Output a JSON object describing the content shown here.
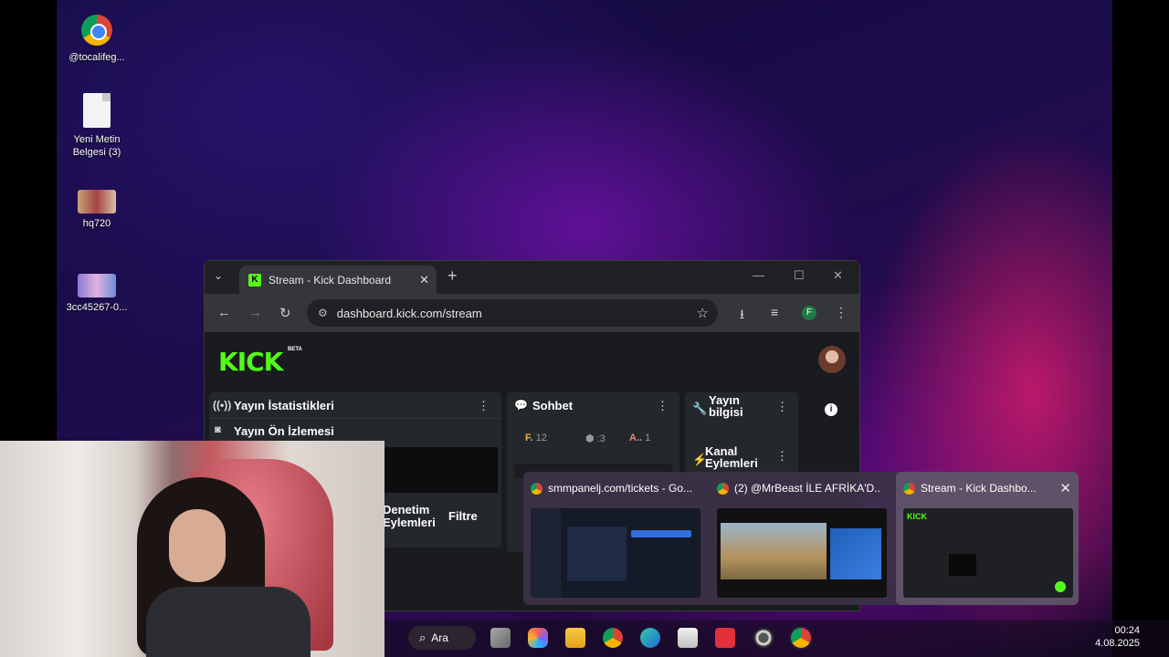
{
  "desktop": {
    "icons": [
      {
        "label": "@tocalifeg...",
        "icon": "chrome-shortcut-icon"
      },
      {
        "label": "Yeni Metin Belgesi (3)",
        "icon": "text-file-icon"
      },
      {
        "label": "hq720",
        "icon": "image-file-icon"
      },
      {
        "label": "3cc45267-0...",
        "icon": "image-file-icon"
      }
    ]
  },
  "browser": {
    "tab": {
      "title": "Stream - Kick Dashboard",
      "close": "✕"
    },
    "new_tab": "+",
    "controls": {
      "minimize": "—",
      "maximize": "☐",
      "close": "✕"
    },
    "url": "dashboard.kick.com/stream",
    "profile_initial": "F"
  },
  "kick": {
    "logo": "KICK",
    "beta": "BETA",
    "panels": {
      "stats": "Yayın İstatistikleri",
      "preview": "Yayın Ön İzlemesi",
      "chat": "Sohbet",
      "info": "Yayın bilgisi",
      "channel": "Kanal Eylemleri",
      "moderation": "Denetim Eylemleri",
      "filter": "Filtre"
    },
    "chat_chips": [
      {
        "name": "F.",
        "count": "12"
      },
      {
        "name": "",
        "count": "3"
      },
      {
        "name": "A..",
        "count": "1"
      }
    ]
  },
  "switcher": {
    "items": [
      {
        "title": "smmpanelj.com/tickets - Go..."
      },
      {
        "title": "(2) @MrBeast İLE AFRİKA'D..."
      },
      {
        "title": "Stream - Kick Dashbo..."
      }
    ],
    "close": "✕"
  },
  "taskbar": {
    "search_label": "Ara",
    "time": "00:24",
    "date": "4.08.2025"
  },
  "colors": {
    "kick_green": "#53fc18",
    "accent_pink": "#e61e6e"
  }
}
